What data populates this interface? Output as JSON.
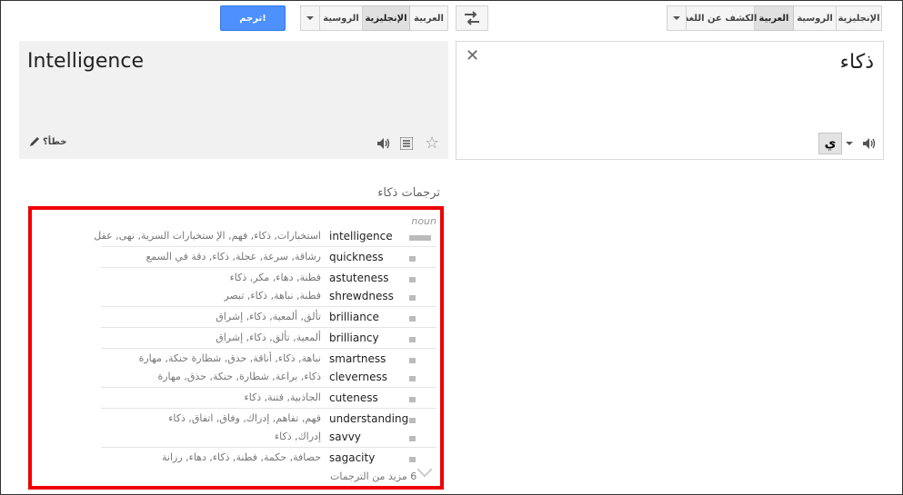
{
  "source_langs": {
    "english": "الإنجليزية",
    "russian": "الروسية",
    "arabic": "العربية",
    "detect": "الكشف عن اللغة"
  },
  "target_langs": {
    "arabic": "العربية",
    "english": "الإنجليزية",
    "russian": "الروسية"
  },
  "translate_button": "ترجم!",
  "source_text": "ذكاء",
  "output_text": "Intelligence",
  "wrong_label": "خطأ؟",
  "keyboard_label": "ي",
  "dictionary": {
    "title": "ترجمات ذكاء",
    "pos": "noun",
    "entries": [
      {
        "term": "intelligence",
        "translations": "استخبارات, ذكاء, فهم, الإ ستخبارات السرية, نهى, عقل"
      },
      {
        "term": "quickness",
        "translations": "رشاقة, سرعة, عجلة, ذكاء, دقة في السمع"
      },
      {
        "term": "astuteness",
        "translations": "فطنة, دهاء, مكر, ذكاء"
      },
      {
        "term": "shrewdness",
        "translations": "فطنة, نباهة, ذكاء, تبصر"
      },
      {
        "term": "brilliance",
        "translations": "تألق, ألمعية, ذكاء, إشراق"
      },
      {
        "term": "brilliancy",
        "translations": "ألمعية, تألق, ذكاء, إشراق"
      },
      {
        "term": "smartness",
        "translations": "نباهة, ذكاء, أناقة, حذق, شطارة حنكة, مهارة"
      },
      {
        "term": "cleverness",
        "translations": "ذكاء, براعة, شطارة, حنكة, حذق, مهارة"
      },
      {
        "term": "cuteness",
        "translations": "الجاذبية, فتنة, ذكاء"
      },
      {
        "term": "understanding",
        "translations": "فهم, تفاهم, إدراك, وفاق, اتفاق, ذكاء"
      },
      {
        "term": "savvy",
        "translations": "إدراك, ذكاء"
      },
      {
        "term": "sagacity",
        "translations": "حصافة, حكمة, فطنة, ذكاء, دهاء, رزانة"
      }
    ],
    "more_label": "6 مزيد من الترجمات"
  }
}
